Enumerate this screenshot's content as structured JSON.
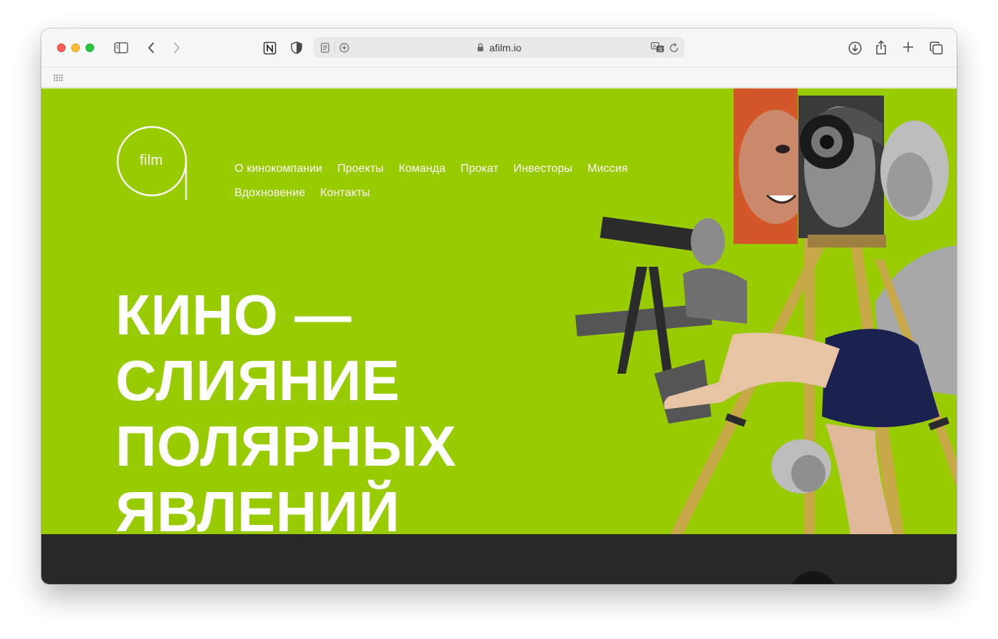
{
  "browser": {
    "url": "afilm.io",
    "icons": [
      "sidebar-icon",
      "back-icon",
      "forward-icon",
      "notion-icon",
      "shield-icon",
      "reader-icon",
      "add-icon",
      "lock-icon",
      "translate-icon",
      "reload-icon",
      "download-icon",
      "share-icon",
      "new-tab-icon",
      "tabs-overview-icon",
      "bookmarks-grid-icon"
    ]
  },
  "site": {
    "logo_text": "film",
    "nav": {
      "row1": [
        "О кинокомпании",
        "Проекты",
        "Команда",
        "Прокат",
        "Инвесторы",
        "Миссия"
      ],
      "row2": [
        "Вдохновение",
        "Контакты"
      ]
    },
    "hero": {
      "lines": [
        "КИНО —",
        "СЛИЯНИЕ",
        "ПОЛЯРНЫХ",
        "ЯВЛЕНИЙ"
      ]
    }
  },
  "colors": {
    "accent": "#99cc00",
    "footer": "#282828",
    "text_on_accent": "#ffffff"
  }
}
